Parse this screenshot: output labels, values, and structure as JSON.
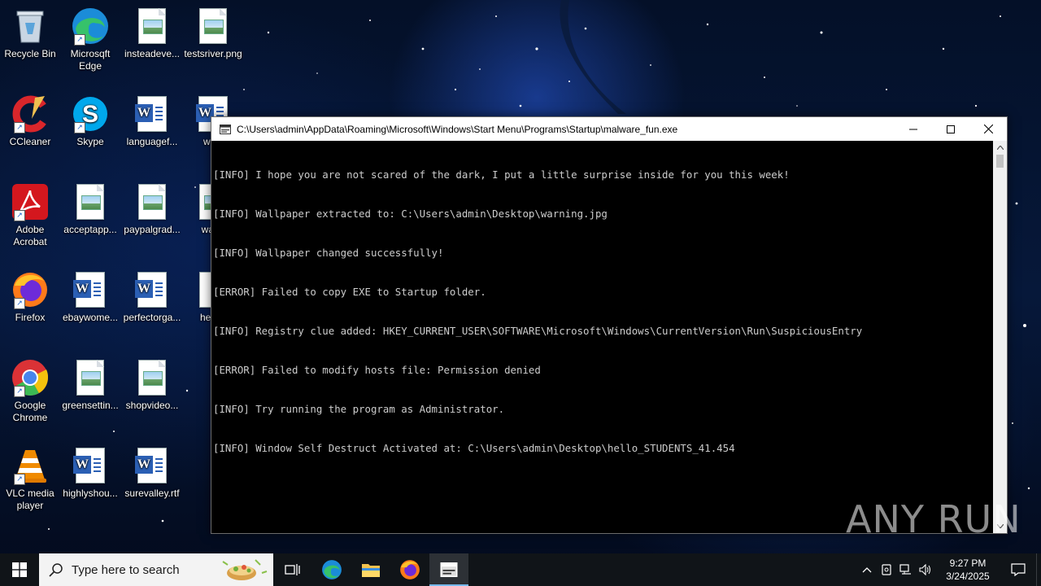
{
  "desktop": {
    "icons": [
      {
        "label": "Recycle Bin"
      },
      {
        "label": "Microsqft Edge"
      },
      {
        "label": "insteadeve..."
      },
      {
        "label": "testsriver.png"
      },
      {
        "label": "CCleaner"
      },
      {
        "label": "Skype"
      },
      {
        "label": "languagef..."
      },
      {
        "label": "wellf"
      },
      {
        "label": "Adobe Acrobat"
      },
      {
        "label": "acceptapp..."
      },
      {
        "label": "paypalgrad..."
      },
      {
        "label": "warni"
      },
      {
        "label": "Firefox"
      },
      {
        "label": "ebaywome..."
      },
      {
        "label": "perfectorga..."
      },
      {
        "label": "hello_"
      },
      {
        "label": "Google Chrome"
      },
      {
        "label": "greensettin..."
      },
      {
        "label": "shopvideo..."
      },
      {
        "label": "VLC media player"
      },
      {
        "label": "highlyshou..."
      },
      {
        "label": "surevalley.rtf"
      }
    ]
  },
  "console_window": {
    "title": "C:\\Users\\admin\\AppData\\Roaming\\Microsoft\\Windows\\Start Menu\\Programs\\Startup\\malware_fun.exe",
    "lines": [
      "[INFO] I hope you are not scared of the dark, I put a little surprise inside for you this week!",
      "[INFO] Wallpaper extracted to: C:\\Users\\admin\\Desktop\\warning.jpg",
      "[INFO] Wallpaper changed successfully!",
      "[ERROR] Failed to copy EXE to Startup folder.",
      "[INFO] Registry clue added: HKEY_CURRENT_USER\\SOFTWARE\\Microsoft\\Windows\\CurrentVersion\\Run\\SuspiciousEntry",
      "[ERROR] Failed to modify hosts file: Permission denied",
      "[INFO] Try running the program as Administrator.",
      "[INFO] Window Self Destruct Activated at: C:\\Users\\admin\\Desktop\\hello_STUDENTS_41.454"
    ]
  },
  "watermark": {
    "text": "ANY RUN"
  },
  "taskbar": {
    "search_placeholder": "Type here to search",
    "clock_time": "9:27 PM",
    "clock_date": "3/24/2025"
  }
}
